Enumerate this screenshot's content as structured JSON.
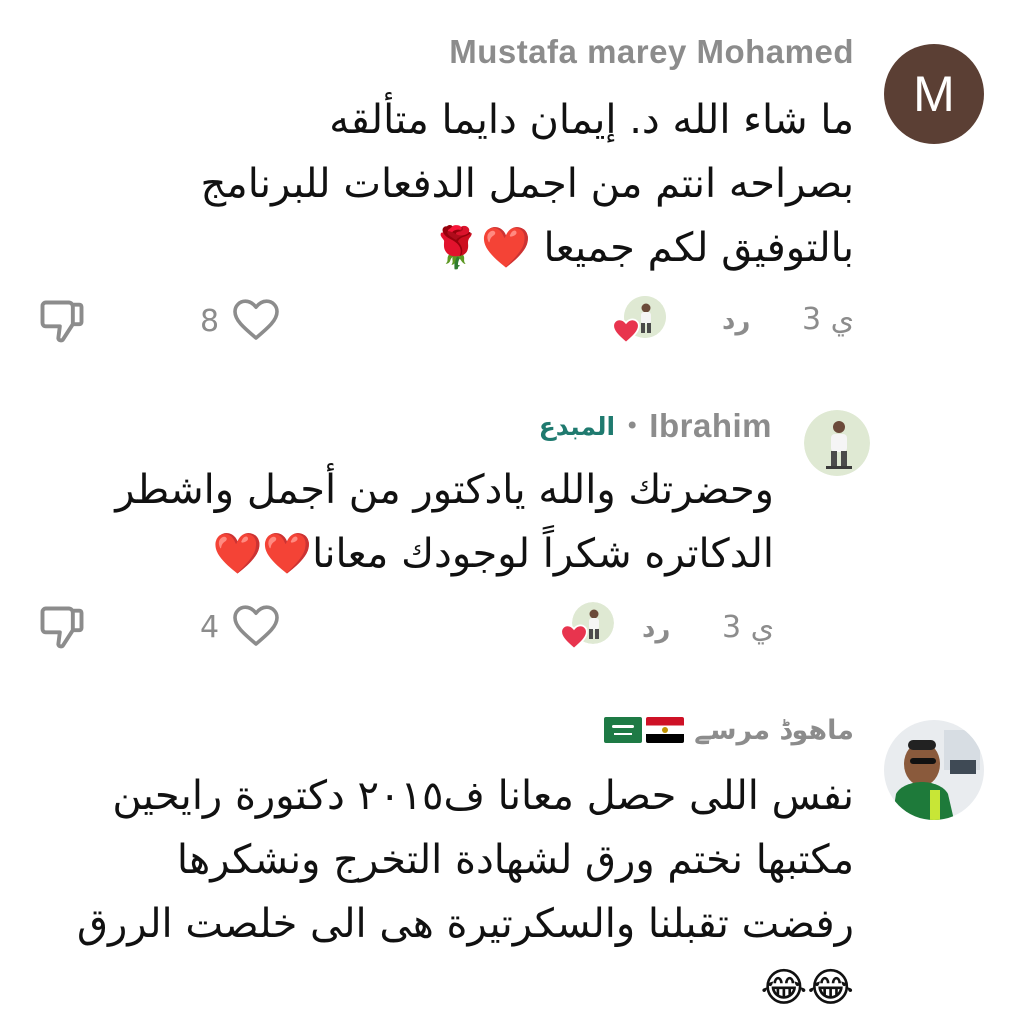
{
  "comments": [
    {
      "author": "Mustafa marey Mohamed",
      "avatar_letter": "M",
      "lines": [
        "ما شاء الله د. إيمان دايما متألقه",
        "بصراحه انتم من اجمل الدفعات للبرنامج",
        "بالتوفيق لكم جميعا ❤️🌹"
      ],
      "time": "3 ي",
      "reply_label": "رد",
      "like_count": "8"
    },
    {
      "author": "Ibrahim",
      "badge": "المبدع",
      "lines": [
        "وحضرتك والله يادكتور من أجمل واشطر",
        "الدكاتره شكراً لوجودك معانا❤️❤️"
      ],
      "time": "3 ي",
      "reply_label": "رد",
      "like_count": "4"
    },
    {
      "author": "ماهوڈ مرسے",
      "flags": [
        "egypt-flag",
        "saudi-flag"
      ],
      "lines": [
        "نفس اللى حصل معانا ف٢٠١٥ دكتورة رايحين",
        "مكتبها نختم ورق لشهادة التخرج ونشكرها",
        "رفضت تقبلنا والسكرتيرة هى الى خلصت الررق",
        "😂😂"
      ]
    }
  ],
  "icons": {
    "like": "heart-outline-icon",
    "dislike": "thumbs-down-icon",
    "creator_heart": "creator-heart-icon"
  },
  "colors": {
    "avatar_bg": "#5b3f34",
    "badge": "#1f7a6f",
    "muted": "#8c8c8c",
    "heart": "#e8344e"
  }
}
